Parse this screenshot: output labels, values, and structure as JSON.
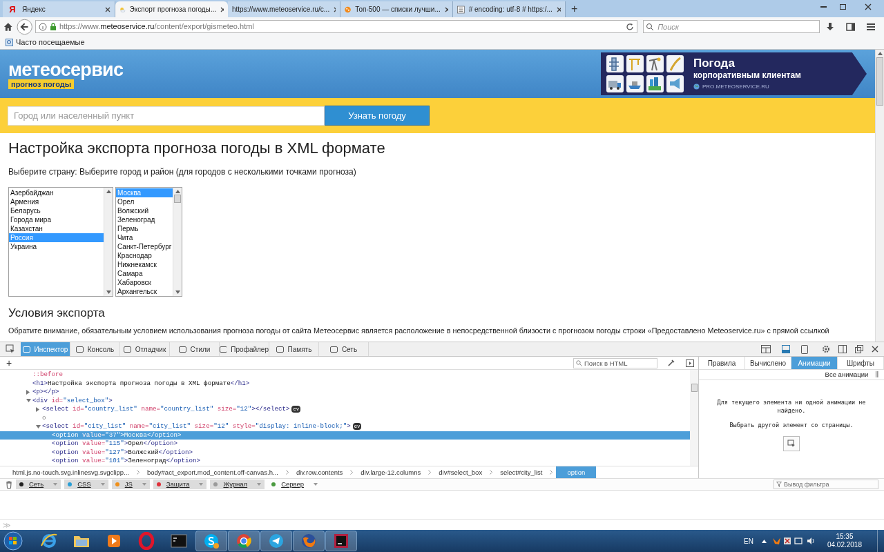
{
  "browser": {
    "tabs": [
      {
        "title": "Яндекс",
        "kind": "letter",
        "icon_text": "Я",
        "selected": false
      },
      {
        "title": "Экспорт прогноза погоды...",
        "kind": "weather",
        "selected": true
      },
      {
        "title": "https://www.meteoservice.ru/c...",
        "kind": "plain",
        "selected": false
      },
      {
        "title": "Топ-500 — списки лучши...",
        "kind": "orange",
        "selected": false
      },
      {
        "title": "# encoding: utf-8 # https:/...",
        "kind": "grid",
        "selected": false
      }
    ],
    "new_tab": "+",
    "url_prefix": "https://www.",
    "url_domain": "meteoservice.ru",
    "url_path": "/content/export/gismeteo.html",
    "search_placeholder": "Поиск",
    "bookmarks": [
      "Часто посещаемые"
    ]
  },
  "page": {
    "logo": "метеосервис",
    "tagline": "прогноз погоды",
    "banner": {
      "title": "Погода",
      "subtitle": "корпоративным клиентам",
      "link": "PRO.METEOSERVICE.RU"
    },
    "city_search": {
      "placeholder": "Город или населенный пункт",
      "button": "Узнать погоду"
    },
    "heading": "Настройка экспорта прогноза погоды в XML формате",
    "prompt": "Выберите страну: Выберите город и район (для городов с несколькими точками прогноза)",
    "countries": [
      {
        "label": "Азербайджан",
        "selected": false
      },
      {
        "label": "Армения",
        "selected": false
      },
      {
        "label": "Беларусь",
        "selected": false
      },
      {
        "label": "Города мира",
        "selected": false
      },
      {
        "label": "Казахстан",
        "selected": false
      },
      {
        "label": "Россия",
        "selected": true
      },
      {
        "label": "Украина",
        "selected": false
      }
    ],
    "cities": [
      {
        "label": "Москва",
        "selected": true
      },
      {
        "label": "Орел",
        "selected": false
      },
      {
        "label": "Волжский",
        "selected": false
      },
      {
        "label": "Зеленоград",
        "selected": false
      },
      {
        "label": "Пермь",
        "selected": false
      },
      {
        "label": "Чита",
        "selected": false
      },
      {
        "label": "Санкт-Петербург",
        "selected": false
      },
      {
        "label": "Краснодар",
        "selected": false
      },
      {
        "label": "Нижнекамск",
        "selected": false
      },
      {
        "label": "Самара",
        "selected": false
      },
      {
        "label": "Хабаровск",
        "selected": false
      },
      {
        "label": "Архангельск",
        "selected": false
      }
    ],
    "section_heading": "Условия экспорта",
    "paragraph": "Обратите внимание, обязательным условием использования прогноза погоды от сайта Метеосервис является расположение в непосредственной близости с прогнозом погоды строки «Предоставлено Meteoservice.ru» с прямой ссылкой"
  },
  "devtools": {
    "tools": [
      {
        "label": "Инспектор",
        "selected": true
      },
      {
        "label": "Консоль",
        "selected": false
      },
      {
        "label": "Отладчик",
        "selected": false
      },
      {
        "label": "Стили",
        "selected": false
      },
      {
        "label": "Профайлер",
        "selected": false
      },
      {
        "label": "Память",
        "selected": false
      },
      {
        "label": "Сеть",
        "selected": false
      }
    ],
    "html_search_placeholder": "Поиск в HTML",
    "add_node": "+",
    "tree": [
      {
        "selected": false,
        "tokens": [
          {
            "kind": "pseudo",
            "text": "::before"
          }
        ]
      },
      {
        "selected": false,
        "tokens": [
          {
            "kind": "tag",
            "text": "<h1>"
          },
          {
            "kind": "text",
            "text": "Настройка экспорта прогноза погоды в XML формате"
          },
          {
            "kind": "tag",
            "text": "</h1>"
          }
        ]
      },
      {
        "expanded": false,
        "selected": false,
        "tokens": [
          {
            "kind": "tag",
            "text": "<p></p>"
          }
        ]
      },
      {
        "expanded": true,
        "selected": false,
        "tokens": [
          {
            "kind": "tag",
            "text": "<div"
          },
          {
            "kind": "attr",
            "text": " id="
          },
          {
            "kind": "value",
            "text": "\"select_box\""
          },
          {
            "kind": "tag",
            "text": ">"
          }
        ],
        "children": [
          {
            "expanded": false,
            "selected": false,
            "badge": "ev",
            "tokens": [
              {
                "kind": "tag",
                "text": "<select"
              },
              {
                "kind": "attr",
                "text": " id="
              },
              {
                "kind": "value",
                "text": "\"country_list\""
              },
              {
                "kind": "attr",
                "text": " name="
              },
              {
                "kind": "value",
                "text": "\"country_list\""
              },
              {
                "kind": "attr",
                "text": " size="
              },
              {
                "kind": "value",
                "text": "\"12\""
              },
              {
                "kind": "tag",
                "text": "></select>"
              }
            ]
          },
          {
            "selected": false,
            "tokens": [
              {
                "kind": "whitespace",
                "text": "o"
              }
            ]
          },
          {
            "expanded": true,
            "selected": false,
            "badge": "ev",
            "tokens": [
              {
                "kind": "tag",
                "text": "<select"
              },
              {
                "kind": "attr",
                "text": " id="
              },
              {
                "kind": "value",
                "text": "\"city_list\""
              },
              {
                "kind": "attr",
                "text": " name="
              },
              {
                "kind": "value",
                "text": "\"city_list\""
              },
              {
                "kind": "attr",
                "text": " size="
              },
              {
                "kind": "value",
                "text": "\"12\""
              },
              {
                "kind": "attr",
                "text": " style="
              },
              {
                "kind": "value",
                "text": "\"display: inline-block;\""
              },
              {
                "kind": "tag",
                "text": ">"
              }
            ],
            "children": [
              {
                "selected": true,
                "tokens": [
                  {
                    "kind": "tag",
                    "text": "<option"
                  },
                  {
                    "kind": "attr",
                    "text": " value="
                  },
                  {
                    "kind": "value",
                    "text": "\"37\""
                  },
                  {
                    "kind": "tag",
                    "text": ">"
                  },
                  {
                    "kind": "text",
                    "text": "Москва"
                  },
                  {
                    "kind": "tag",
                    "text": "</option>"
                  }
                ]
              },
              {
                "selected": false,
                "tokens": [
                  {
                    "kind": "tag",
                    "text": "<option"
                  },
                  {
                    "kind": "attr",
                    "text": " value="
                  },
                  {
                    "kind": "value",
                    "text": "\"115\""
                  },
                  {
                    "kind": "tag",
                    "text": ">"
                  },
                  {
                    "kind": "text",
                    "text": "Орел"
                  },
                  {
                    "kind": "tag",
                    "text": "</option>"
                  }
                ]
              },
              {
                "selected": false,
                "tokens": [
                  {
                    "kind": "tag",
                    "text": "<option"
                  },
                  {
                    "kind": "attr",
                    "text": " value="
                  },
                  {
                    "kind": "value",
                    "text": "\"127\""
                  },
                  {
                    "kind": "tag",
                    "text": ">"
                  },
                  {
                    "kind": "text",
                    "text": "Волжский"
                  },
                  {
                    "kind": "tag",
                    "text": "</option>"
                  }
                ]
              },
              {
                "selected": false,
                "tokens": [
                  {
                    "kind": "tag",
                    "text": "<option"
                  },
                  {
                    "kind": "attr",
                    "text": " value="
                  },
                  {
                    "kind": "value",
                    "text": "\"101\""
                  },
                  {
                    "kind": "tag",
                    "text": ">"
                  },
                  {
                    "kind": "text",
                    "text": "Зеленоград"
                  },
                  {
                    "kind": "tag",
                    "text": "</option>"
                  }
                ]
              }
            ]
          }
        ]
      }
    ],
    "breadcrumbs": [
      {
        "label": "html.js.no-touch.svg.inlinesvg.svgclipp...",
        "selected": false
      },
      {
        "label": "body#act_export.mod_content.off-canvas.h...",
        "selected": false
      },
      {
        "label": "div.row.contents",
        "selected": false
      },
      {
        "label": "div.large-12.columns",
        "selected": false
      },
      {
        "label": "div#select_box",
        "selected": false
      },
      {
        "label": "select#city_list",
        "selected": false
      },
      {
        "label": "option",
        "selected": true
      }
    ],
    "side_tabs": [
      {
        "label": "Правила",
        "selected": false
      },
      {
        "label": "Вычислено",
        "selected": false
      },
      {
        "label": "Анимации",
        "selected": true
      },
      {
        "label": "Шрифты",
        "selected": false
      }
    ],
    "all_animations": "Все анимации",
    "pause": "||",
    "animations_message": "Для текущего элемента ни одной анимации не найдено.",
    "pick_link": "Выбрать другой элемент со страницы.",
    "console_filters": [
      {
        "label": "Сеть",
        "color": "#202020",
        "checked": true
      },
      {
        "label": "CSS",
        "color": "#2a9fd6",
        "checked": true
      },
      {
        "label": "JS",
        "color": "#f0901a",
        "checked": true
      },
      {
        "label": "Защита",
        "color": "#e0303a",
        "checked": true
      },
      {
        "label": "Журнал",
        "color": "#9a9a9a",
        "checked": true
      },
      {
        "label": "Сервер",
        "color": "#4a9a40",
        "checked": false
      }
    ],
    "filter_placeholder": "Вывод фильтра",
    "prompt": "≫"
  },
  "taskbar": {
    "apps": [
      {
        "kind": "ie",
        "active": false
      },
      {
        "kind": "folder",
        "active": false
      },
      {
        "kind": "player",
        "active": false
      },
      {
        "kind": "opera",
        "active": false
      },
      {
        "kind": "terminal",
        "active": false
      },
      {
        "kind": "skype",
        "active": true
      },
      {
        "kind": "chrome",
        "active": true
      },
      {
        "kind": "telegram",
        "active": true
      },
      {
        "kind": "firefox",
        "active": true
      },
      {
        "kind": "rm",
        "active": true
      }
    ],
    "language": "EN",
    "time": "15:35",
    "date": "04.02.2018"
  }
}
